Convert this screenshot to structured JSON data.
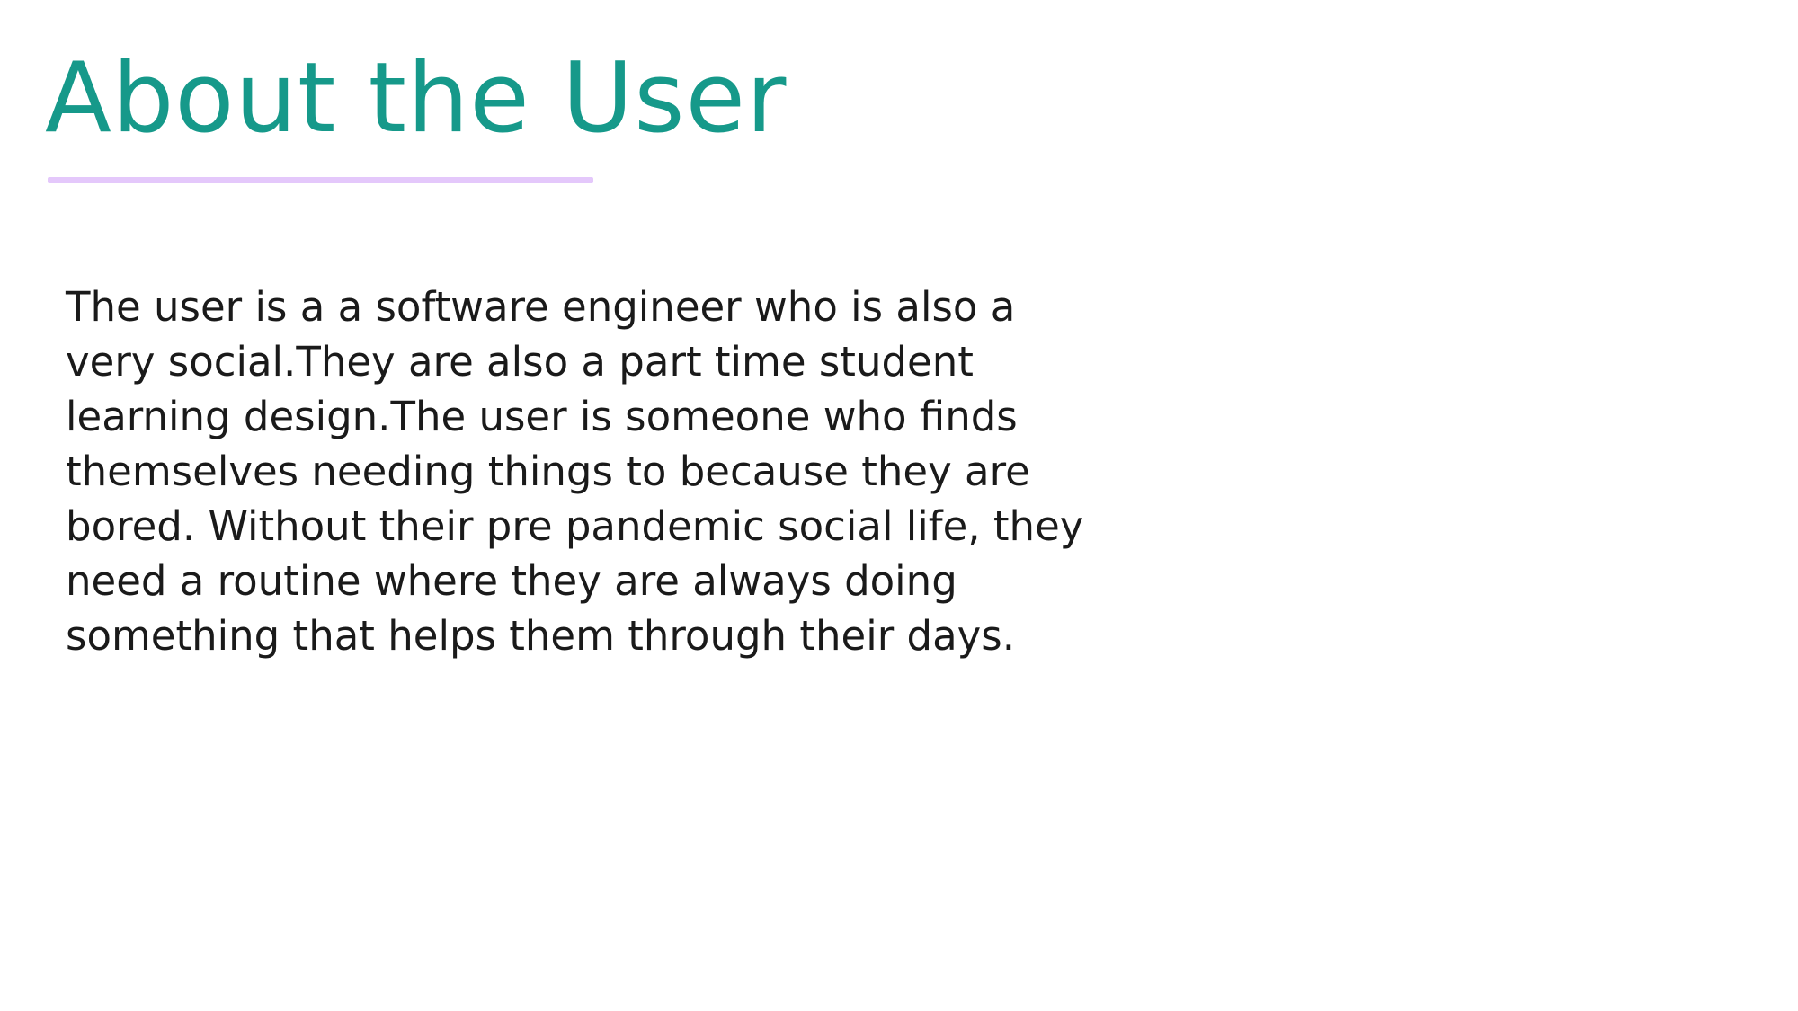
{
  "slide": {
    "title": "About the User",
    "body_lines": [
      "The user is a a software engineer who is also a",
      "very social.They are also a part time student",
      "learning design.The user is someone who finds",
      "themselves needing things to because they are",
      "bored. Without their pre pandemic social life, they",
      "need a routine where they are always doing",
      "something that helps them through their days."
    ]
  },
  "colors": {
    "title": "#16998a",
    "underline": "#e4c8fb",
    "body": "#1a1a1a",
    "background": "#ffffff"
  }
}
